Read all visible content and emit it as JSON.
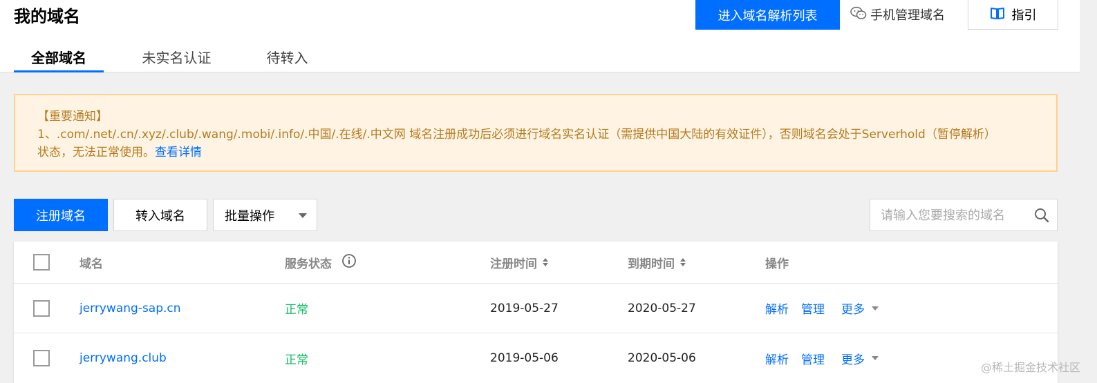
{
  "header": {
    "title": "我的域名",
    "dns_list_button": "进入域名解析列表",
    "mobile_manage": "手机管理域名",
    "guide": "指引"
  },
  "tabs": [
    {
      "label": "全部域名",
      "active": true
    },
    {
      "label": "未实名认证",
      "active": false
    },
    {
      "label": "待转入",
      "active": false
    }
  ],
  "notice": {
    "title": "【重要通知】",
    "line1": "1、.com/.net/.cn/.xyz/.club/.wang/.mobi/.info/.中国/.在线/.中文网 域名注册成功后必须进行域名实名认证（需提供中国大陆的有效证件），否则域名会处于Serverhold（暂停解析）",
    "line2": "状态，无法正常使用。",
    "link": "查看详情"
  },
  "toolbar": {
    "register": "注册域名",
    "transfer": "转入域名",
    "batch": "批量操作",
    "search_placeholder": "请输入您要搜索的域名"
  },
  "table": {
    "headers": {
      "domain": "域名",
      "status": "服务状态",
      "reg_time": "注册时间",
      "exp_time": "到期时间",
      "ops": "操作"
    },
    "rows": [
      {
        "domain": "jerrywang-sap.cn",
        "status": "正常",
        "reg": "2019-05-27",
        "exp": "2020-05-27",
        "op1": "解析",
        "op2": "管理",
        "more": "更多"
      },
      {
        "domain": "jerrywang.club",
        "status": "正常",
        "reg": "2019-05-06",
        "exp": "2020-05-06",
        "op1": "解析",
        "op2": "管理",
        "more": "更多"
      }
    ]
  },
  "watermark": "@稀土掘金技术社区",
  "colors": {
    "primary": "#006eff",
    "notice_bg": "#fff4e3",
    "notice_border": "#ffd18b",
    "notice_text": "#b47a1e",
    "status_ok": "#0abf5b"
  }
}
